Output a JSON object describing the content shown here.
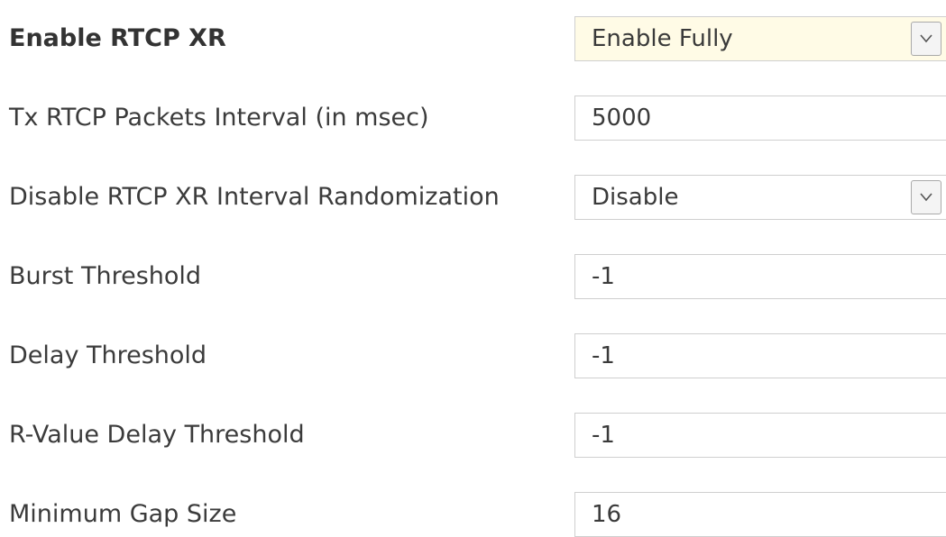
{
  "form": {
    "fields": [
      {
        "label": "Enable RTCP XR",
        "type": "select",
        "value": "Enable Fully"
      },
      {
        "label": "Tx RTCP Packets Interval (in msec)",
        "type": "text",
        "value": "5000"
      },
      {
        "label": "Disable RTCP XR Interval Randomization",
        "type": "select",
        "value": "Disable"
      },
      {
        "label": "Burst Threshold",
        "type": "text",
        "value": "-1"
      },
      {
        "label": "Delay Threshold",
        "type": "text",
        "value": "-1"
      },
      {
        "label": "R-Value Delay Threshold",
        "type": "text",
        "value": "-1"
      },
      {
        "label": "Minimum Gap Size",
        "type": "text",
        "value": "16"
      }
    ]
  },
  "icons": {
    "dropdown": "chevron-down-icon"
  },
  "colors": {
    "modified_field_background": "#fffbe6",
    "label_text": "#3b3b3b",
    "field_border": "#cfcfcf"
  }
}
